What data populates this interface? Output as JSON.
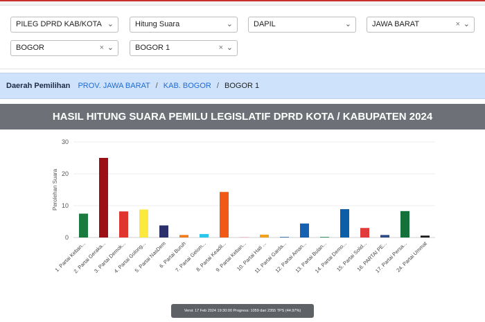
{
  "filters": {
    "election": "PILEG DPRD KAB/KOTA",
    "mode": "Hitung Suara",
    "area_type": "DAPIL",
    "province": "JAWA BARAT",
    "regency": "BOGOR",
    "district": "BOGOR 1"
  },
  "breadcrumb": {
    "label": "Daerah Pemilihan",
    "items": [
      "PROV. JAWA BARAT",
      "KAB. BOGOR",
      "BOGOR 1"
    ]
  },
  "banner": {
    "title": "HASIL HITUNG SUARA PEMILU LEGISLATIF DPRD KOTA / KABUPATEN 2024"
  },
  "chart_data": {
    "type": "bar",
    "ylabel": "Perolehan Suara",
    "ylim": [
      0,
      30
    ],
    "yticks": [
      0,
      10,
      20,
      30
    ],
    "grid": true,
    "categories": [
      "1. Partai Keban...",
      "2. Partai Geraka...",
      "3. Partai Demok...",
      "4. Partai Golong...",
      "5. Partai NasDem",
      "6. Partai Buruh",
      "7. Partai Gelom...",
      "8. Partai Keadil...",
      "9. Partai Keban...",
      "10. Partai Hati ...",
      "11. Partai Garda...",
      "12. Partai Aman...",
      "13. Partai Bulan...",
      "14. Partai Demo...",
      "15. Partai Solid...",
      "16. PARTAI PE...",
      "17. Partai Persa...",
      "24. Partai Ummat"
    ],
    "values": [
      7.5,
      25,
      8.2,
      8.8,
      3.8,
      0.8,
      1.1,
      14.3,
      0.1,
      0.9,
      0.2,
      4.4,
      0.2,
      8.9,
      3,
      0.8,
      8.3,
      0.6
    ],
    "colors": [
      "#1b7a3e",
      "#9b0f15",
      "#e0342f",
      "#fde840",
      "#2b2f6b",
      "#f07c1a",
      "#2bc6ea",
      "#f15a16",
      "#f7b0c4",
      "#f0a21c",
      "#3c6fa8",
      "#1560b0",
      "#2e8b57",
      "#0d5ea8",
      "#e23b3b",
      "#2f4b8a",
      "#15713a",
      "#1a1a1a"
    ]
  },
  "footer": {
    "text": "Versi: 17 Feb 2024 19:30:00 Progress: 1059 dari 2355 TPS (44.97%)"
  }
}
